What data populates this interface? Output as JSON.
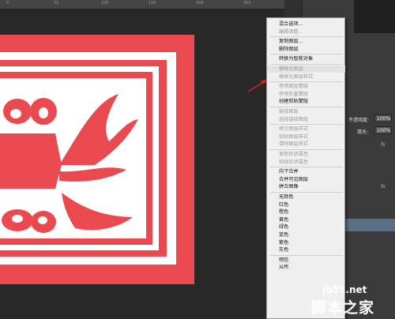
{
  "ruler": {
    "ticks": [
      "0",
      "50",
      "100",
      "150",
      "200",
      "250"
    ]
  },
  "context_menu": {
    "items": [
      {
        "label": "混合选项...",
        "disabled": false
      },
      {
        "label": "编辑调整...",
        "disabled": true
      },
      {
        "sep": true
      },
      {
        "label": "复制图层...",
        "disabled": false
      },
      {
        "label": "删除图层",
        "disabled": false
      },
      {
        "sep": true
      },
      {
        "label": "转换为智能对象",
        "disabled": false
      },
      {
        "sep": true
      },
      {
        "label": "栅格化图层",
        "disabled": true,
        "highlight": true
      },
      {
        "label": "栅格化图层样式",
        "disabled": true
      },
      {
        "sep": true
      },
      {
        "label": "停用图层蒙版",
        "disabled": true
      },
      {
        "label": "停用矢量蒙版",
        "disabled": true
      },
      {
        "label": "创建剪贴蒙版",
        "disabled": false
      },
      {
        "sep": true
      },
      {
        "label": "链接图层",
        "disabled": true
      },
      {
        "label": "选择链接图层",
        "disabled": true
      },
      {
        "sep": true
      },
      {
        "label": "拷贝图层样式",
        "disabled": true
      },
      {
        "label": "粘贴图层样式",
        "disabled": true
      },
      {
        "label": "清除图层样式",
        "disabled": true
      },
      {
        "sep": true
      },
      {
        "label": "复制形状属性",
        "disabled": true
      },
      {
        "label": "粘贴形状属性",
        "disabled": true
      },
      {
        "sep": true
      },
      {
        "label": "向下合并",
        "disabled": false
      },
      {
        "label": "合并可见图层",
        "disabled": false
      },
      {
        "label": "拼合图像",
        "disabled": false
      },
      {
        "sep": true
      },
      {
        "label": "无颜色",
        "disabled": false
      },
      {
        "label": "红色",
        "disabled": false
      },
      {
        "label": "橙色",
        "disabled": false
      },
      {
        "label": "黄色",
        "disabled": false
      },
      {
        "label": "绿色",
        "disabled": false
      },
      {
        "label": "蓝色",
        "disabled": false
      },
      {
        "label": "紫色",
        "disabled": false
      },
      {
        "label": "灰色",
        "disabled": false
      },
      {
        "sep": true
      },
      {
        "label": "明信",
        "disabled": false
      },
      {
        "label": "从所",
        "disabled": false
      }
    ]
  },
  "layers_panel": {
    "opacity_label": "不透明度:",
    "opacity_value": "100%",
    "fill_label": "填充:",
    "fill_value": "100%",
    "fx_label": "fx"
  },
  "watermark": {
    "url": "jb51.net",
    "name": "脚本之家"
  },
  "colors": {
    "art_red": "#ea4a4f",
    "menu_bg": "#f0f0f0",
    "arrow_red": "#e02020"
  }
}
